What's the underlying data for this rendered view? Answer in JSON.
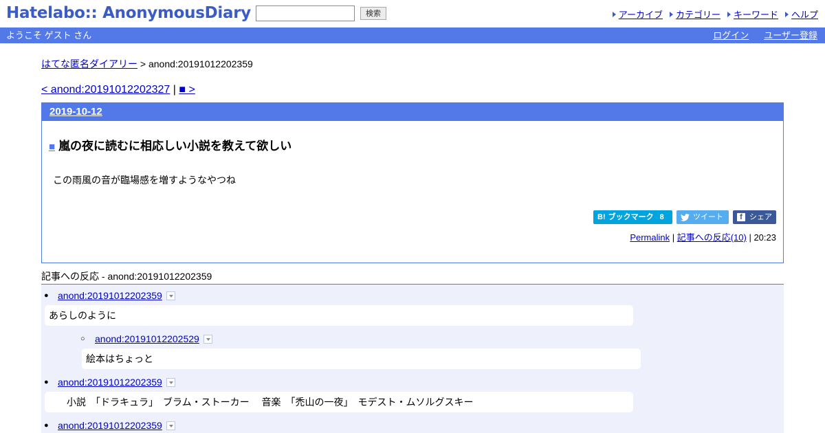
{
  "header": {
    "logo": "Hatelabo:: AnonymousDiary",
    "search_placeholder": "",
    "search_button": "検索",
    "nav": [
      "アーカイブ",
      "カテゴリー",
      "キーワード",
      "ヘルプ"
    ]
  },
  "bar": {
    "welcome": "ようこそ ゲスト さん",
    "login": "ログイン",
    "register": "ユーザー登録"
  },
  "breadcrumb": {
    "home": "はてな匿名ダイアリー",
    "sep": " > ",
    "current": "anond:20191012202359"
  },
  "pager": {
    "prev": "< anond:20191012202327",
    "sep": " | ",
    "next": "■ >"
  },
  "entry": {
    "date": "2019-10-12",
    "title_marker": "■",
    "title": "嵐の夜に読むに相応しい小説を教えて欲しい",
    "body": "この雨風の音が臨場感を増すようなやつね",
    "hatebu_label": "ブックマーク",
    "hatebu_count": "8",
    "tweet_label": "ツイート",
    "share_label": "シェア",
    "permalink": "Permalink",
    "footer_sep": " | ",
    "reactions_link": "記事への反応(10)",
    "time": "20:23"
  },
  "reactions": {
    "title": "記事への反応 - anond:20191012202359",
    "items": [
      {
        "id": "anond:20191012202359",
        "body": "あらしのように"
      },
      {
        "id": "anond:20191012202529",
        "body": "絵本はちょっと"
      },
      {
        "id": "anond:20191012202359",
        "body": "　小説　「ドラキュラ」　ブラム・ストーカー　 音楽　「禿山の一夜」　モデスト・ムソルグスキー"
      },
      {
        "id": "anond:20191012202359",
        "body": ""
      }
    ]
  },
  "colors": {
    "brand": "#5279e7",
    "logo": "#3b5cc4",
    "link": "#0000cc",
    "reactions_bg": "#eef1fc",
    "hatebu": "#00a4de",
    "twitter": "#55acee",
    "facebook": "#3b5998"
  }
}
